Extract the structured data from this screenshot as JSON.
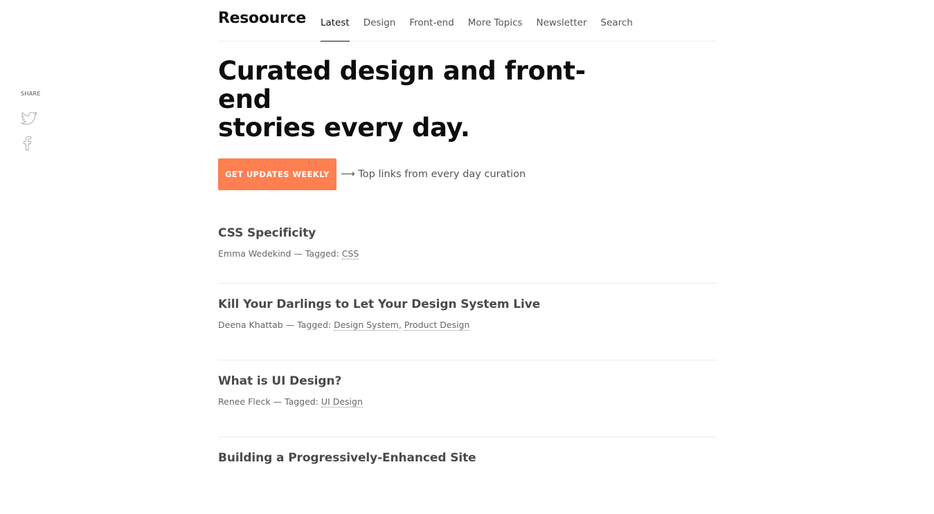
{
  "share": {
    "label": "SHARE",
    "icons": [
      "twitter-icon",
      "facebook-icon"
    ]
  },
  "header": {
    "logo": "Resoource",
    "nav": [
      {
        "label": "Latest",
        "active": true
      },
      {
        "label": "Design",
        "active": false
      },
      {
        "label": "Front-end",
        "active": false
      },
      {
        "label": "More Topics",
        "active": false
      },
      {
        "label": "Newsletter",
        "active": false
      },
      {
        "label": "Search",
        "active": false
      }
    ]
  },
  "hero": {
    "title_line1": "Curated design and front-end",
    "title_line2": "stories every day.",
    "cta_label": "GET UPDATES WEEKLY",
    "cta_note": "⟶ Top links from every day curation",
    "accent_color": "#ff7f50"
  },
  "articles": [
    {
      "title": "CSS Specificity",
      "author": "Emma Wedekind",
      "tagged_prefix": " — Tagged: ",
      "tags": [
        "CSS"
      ]
    },
    {
      "title": "Kill Your Darlings to Let Your Design System Live",
      "author": "Deena Khattab",
      "tagged_prefix": " — Tagged: ",
      "tags": [
        "Design System",
        "Product Design"
      ]
    },
    {
      "title": "What is UI Design?",
      "author": "Renee Fleck",
      "tagged_prefix": " — Tagged: ",
      "tags": [
        "UI Design"
      ]
    },
    {
      "title": "Building a Progressively-Enhanced Site",
      "author": "",
      "tagged_prefix": "",
      "tags": []
    }
  ]
}
